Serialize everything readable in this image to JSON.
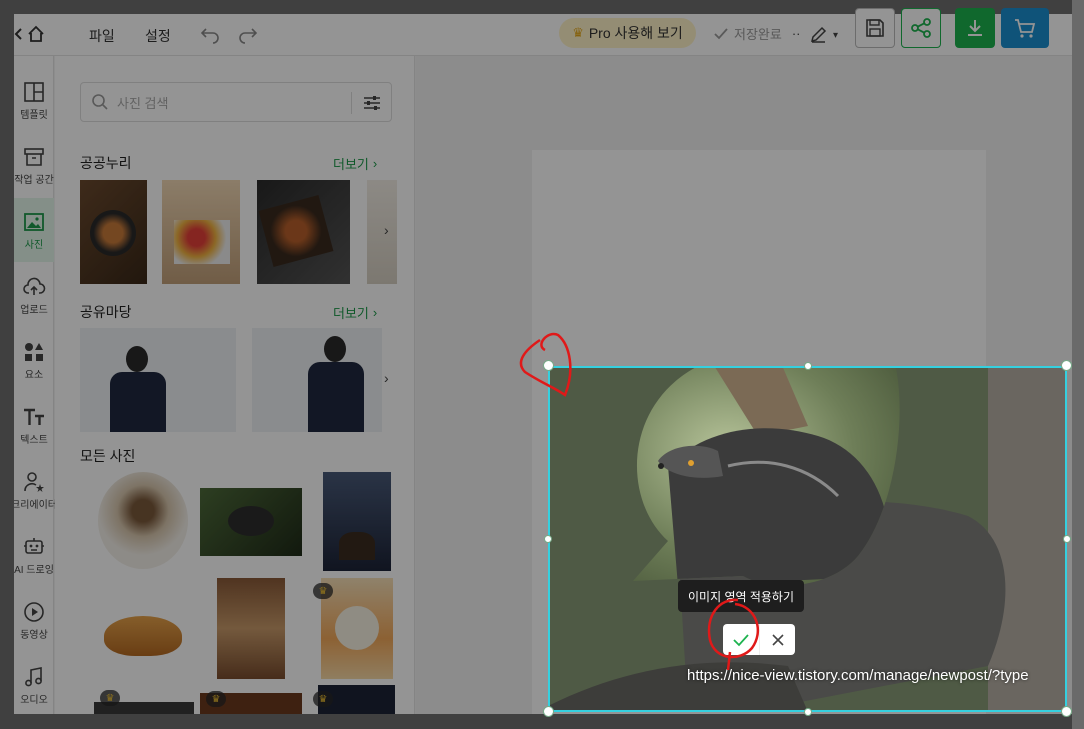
{
  "topbar": {
    "menu": [
      "파일",
      "설정"
    ],
    "pro_label": "Pro 사용해 보기",
    "saved_label": "저장완료"
  },
  "rail": [
    {
      "label": "템플릿",
      "icon": "template-icon"
    },
    {
      "label": "작업 공간",
      "icon": "archive-icon"
    },
    {
      "label": "사진",
      "icon": "photo-icon",
      "active": true
    },
    {
      "label": "업로드",
      "icon": "upload-cloud-icon"
    },
    {
      "label": "요소",
      "icon": "shapes-icon"
    },
    {
      "label": "텍스트",
      "icon": "text-icon"
    },
    {
      "label": "크리에이터",
      "icon": "creator-icon"
    },
    {
      "label": "AI 드로잉",
      "icon": "ai-robot-icon"
    },
    {
      "label": "동영상",
      "icon": "play-icon"
    },
    {
      "label": "오디오",
      "icon": "music-icon"
    }
  ],
  "panel": {
    "search_placeholder": "사진 검색",
    "sections": [
      {
        "title": "공공누리",
        "more": "더보기"
      },
      {
        "title": "공유마당",
        "more": "더보기"
      },
      {
        "title": "모든 사진"
      }
    ]
  },
  "crop": {
    "tooltip": "이미지 영역 적용하기"
  },
  "watermark_url": "https://nice-view.tistory.com/manage/newpost/?type",
  "colors": {
    "accent_green": "#1db34f",
    "cart_blue": "#1a8fd1",
    "crop_border": "#35d0df",
    "annotation_red": "#e01919"
  }
}
